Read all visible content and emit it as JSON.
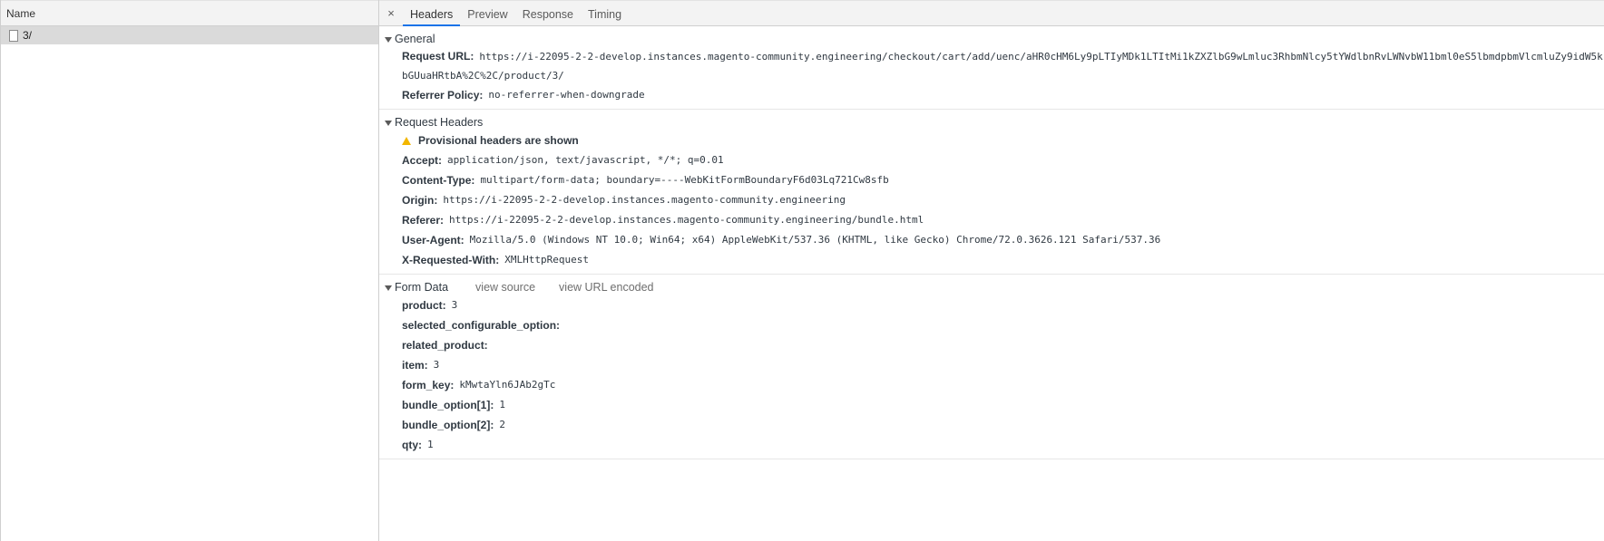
{
  "left": {
    "column_header": "Name",
    "requests": [
      {
        "name": "3/"
      }
    ]
  },
  "tabs": {
    "close": "×",
    "items": [
      "Headers",
      "Preview",
      "Response",
      "Timing"
    ],
    "active": "Headers"
  },
  "general": {
    "title": "General",
    "request_url_label": "Request URL:",
    "request_url": "https://i-22095-2-2-develop.instances.magento-community.engineering/checkout/cart/add/uenc/aHR0cHM6Ly9pLTIyMDk1LTItMi1kZXZlbG9wLmluc3RhbmNlcy5tYWdlbnRvLWNvbW11bml0eS5lbmdpbmVlcmluZy9idW5kbGUuaHRtbA%2C%2C/product/3/",
    "referrer_policy_label": "Referrer Policy:",
    "referrer_policy": "no-referrer-when-downgrade"
  },
  "request_headers": {
    "title": "Request Headers",
    "warning": "Provisional headers are shown",
    "headers": [
      {
        "k": "Accept:",
        "v": "application/json, text/javascript, */*; q=0.01"
      },
      {
        "k": "Content-Type:",
        "v": "multipart/form-data; boundary=----WebKitFormBoundaryF6d03Lq721Cw8sfb"
      },
      {
        "k": "Origin:",
        "v": "https://i-22095-2-2-develop.instances.magento-community.engineering"
      },
      {
        "k": "Referer:",
        "v": "https://i-22095-2-2-develop.instances.magento-community.engineering/bundle.html"
      },
      {
        "k": "User-Agent:",
        "v": "Mozilla/5.0 (Windows NT 10.0; Win64; x64) AppleWebKit/537.36 (KHTML, like Gecko) Chrome/72.0.3626.121 Safari/537.36"
      },
      {
        "k": "X-Requested-With:",
        "v": "XMLHttpRequest"
      }
    ]
  },
  "form_data": {
    "title": "Form Data",
    "view_source": "view source",
    "view_url_encoded": "view URL encoded",
    "fields": [
      {
        "k": "product:",
        "v": "3"
      },
      {
        "k": "selected_configurable_option:",
        "v": ""
      },
      {
        "k": "related_product:",
        "v": ""
      },
      {
        "k": "item:",
        "v": "3"
      },
      {
        "k": "form_key:",
        "v": "kMwtaYln6JAb2gTc"
      },
      {
        "k": "bundle_option[1]:",
        "v": "1"
      },
      {
        "k": "bundle_option[2]:",
        "v": "2"
      },
      {
        "k": "qty:",
        "v": "1"
      }
    ]
  }
}
